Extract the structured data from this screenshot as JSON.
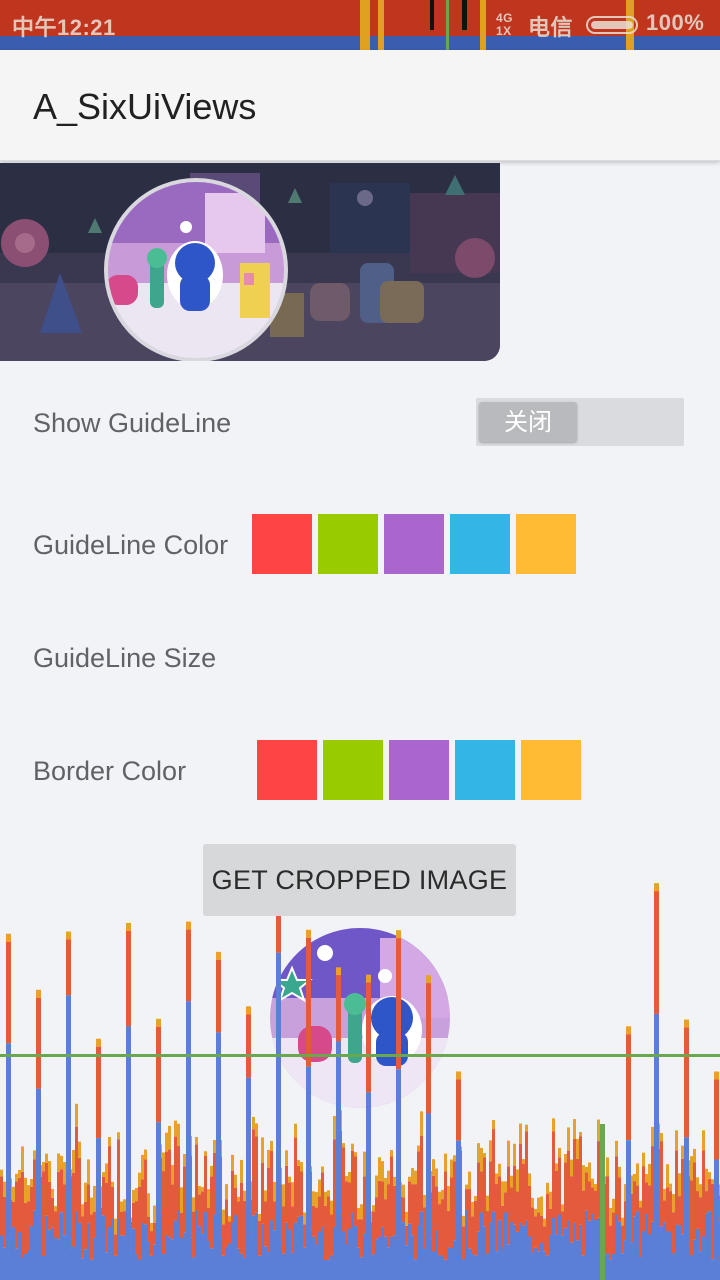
{
  "status_bar": {
    "time": "中午12:21",
    "network": "4G 1X",
    "carrier": "电信",
    "battery": "100%"
  },
  "app_bar": {
    "title": "A_SixUiViews"
  },
  "settings": {
    "show_guideline": {
      "label": "Show GuideLine",
      "switch_text": "关闭",
      "checked": false
    },
    "guideline_color": {
      "label": "GuideLine Color",
      "colors": [
        "#ff4444",
        "#99cc00",
        "#aa66cc",
        "#33b5e5",
        "#ffbb33"
      ]
    },
    "guideline_size": {
      "label": "GuideLine Size"
    },
    "border_color": {
      "label": "Border Color",
      "colors": [
        "#ff4444",
        "#99cc00",
        "#aa66cc",
        "#33b5e5",
        "#ffbb33"
      ]
    }
  },
  "actions": {
    "crop_button_label": "GET CROPPED IMAGE"
  },
  "images": {
    "source_preview": "photo of toy figures with circular crop overlay",
    "cropped_result": "circular cropped toy figures"
  },
  "colors": {
    "background": "#f2f3f7",
    "profiler_red": "#e45a3c",
    "profiler_blue": "#5b7fd6",
    "profiler_orange": "#e8a22b",
    "profiler_green": "#6aa84f"
  }
}
